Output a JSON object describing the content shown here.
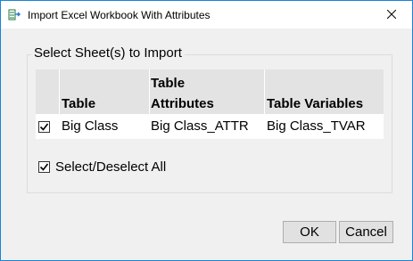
{
  "window": {
    "title": "Import Excel Workbook With Attributes",
    "app_icon": "workbook-import-icon",
    "close_icon": "close-icon"
  },
  "sheets_group": {
    "legend": "Select Sheet(s) to Import",
    "columns": {
      "table": "Table",
      "attributes_line1": "Table",
      "attributes_line2": "Attributes",
      "variables": "Table Variables"
    },
    "rows": [
      {
        "checked": true,
        "table": "Big Class",
        "attributes": "Big Class_ATTR",
        "variables": "Big Class_TVAR"
      }
    ],
    "select_all": {
      "checked": true,
      "label": "Select/Deselect All"
    }
  },
  "buttons": {
    "ok": "OK",
    "cancel": "Cancel"
  }
}
